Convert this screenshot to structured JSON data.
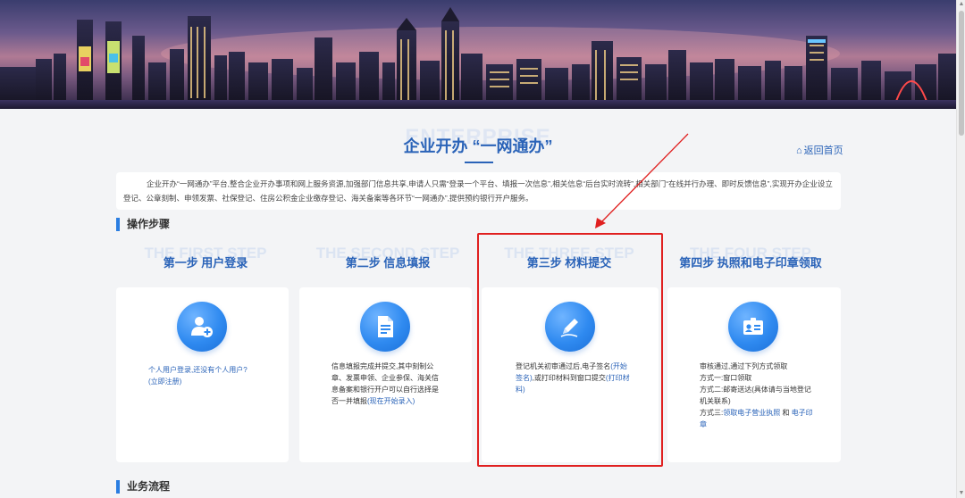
{
  "header": {
    "bg_word": "ENTERPRISE",
    "title": "企业开办 “一网通办”",
    "back_home": "返回首页"
  },
  "intro": "企业开办“一网通办”平台,整合企业开办事项和网上服务资源,加强部门信息共享,申请人只需“登录一个平台、填报一次信息”,相关信息“后台实时流转”,相关部门“在线并行办理、即时反馈信息”,实现开办企业设立登记、公章刻制、申领发票、社保登记、住房公积金企业缴存登记、海关备案等各环节“一网通办”,提供预约银行开户服务。",
  "sections": {
    "steps_title": "操作步骤",
    "process_title": "业务流程"
  },
  "steps": [
    {
      "en": "THE FIRST STEP",
      "cn": "第一步 用户登录",
      "icon": "user-add-icon",
      "text_pre": "个人用户登录,还没有个人用户?",
      "link1": "(立即注册)"
    },
    {
      "en": "THE SECOND STEP",
      "cn": "第二步 信息填报",
      "icon": "document-icon",
      "text_pre": "信息填报完成并提交,其中刻制公章、发票申领、企业参保、海关信息备案和银行开户可以自行选择是否一并填报",
      "link1": "(现在开始录入)"
    },
    {
      "en": "THE THREE STEP",
      "cn": "第三步 材料提交",
      "icon": "pen-icon",
      "text_pre": "登记机关初审通过后,电子签名",
      "link1": "(开始签名)",
      "text_mid": ",或打印材料到窗口提交",
      "link2": "(打印材料)"
    },
    {
      "en": "THE FOUR STEP",
      "cn": "第四步 执照和电子印章领取",
      "icon": "id-card-icon",
      "line1": "审核通过,通过下列方式领取",
      "line2": "方式一:窗口领取",
      "line3": "方式二:邮寄送达(具体请与当地登记机关联系)",
      "line4_pre": "方式三:",
      "link1": "领取电子营业执照",
      "and": " 和 ",
      "link2": "电子印章"
    }
  ],
  "colors": {
    "accent": "#2a63b8",
    "highlight": "#e02020",
    "icon_blue": "#2f8af0"
  }
}
